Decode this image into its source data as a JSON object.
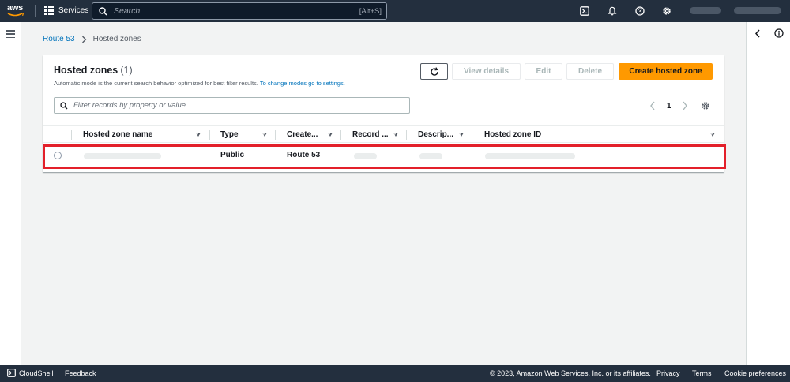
{
  "topnav": {
    "logo_text": "aws",
    "services_label": "Services",
    "search_placeholder": "Search",
    "search_shortcut": "[Alt+S]"
  },
  "breadcrumb": {
    "root": "Route 53",
    "current": "Hosted zones"
  },
  "panel": {
    "title": "Hosted zones",
    "count": "(1)",
    "description": "Automatic mode is the current search behavior optimized for best filter results.",
    "description_link": "To change modes go to settings.",
    "buttons": {
      "view_details": "View details",
      "edit": "Edit",
      "delete": "Delete",
      "create": "Create hosted zone"
    },
    "filter_placeholder": "Filter records by property or value",
    "page_number": "1"
  },
  "table": {
    "columns": [
      "Hosted zone name",
      "Type",
      "Create...",
      "Record ...",
      "Descrip...",
      "Hosted zone ID"
    ],
    "rows": [
      {
        "name": "",
        "type": "Public",
        "created_by": "Route 53",
        "record_count": "",
        "description": "",
        "zone_id": ""
      }
    ]
  },
  "footer": {
    "cloudshell": "CloudShell",
    "feedback": "Feedback",
    "copyright": "© 2023, Amazon Web Services, Inc. or its affiliates.",
    "privacy": "Privacy",
    "terms": "Terms",
    "cookie_preferences": "Cookie preferences"
  },
  "colors": {
    "nav_bg": "#232f3e",
    "primary_button": "#ff9900",
    "link": "#0073bb",
    "highlight": "#e3202a"
  }
}
